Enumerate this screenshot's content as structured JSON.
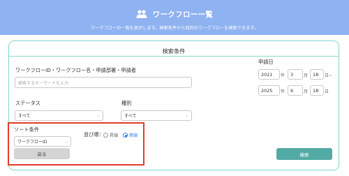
{
  "header": {
    "title": "ワークフロー一覧",
    "subtitle": "ワークフローの一覧を表示します。検索条件から目的のワークフローを検索できます。",
    "icon": "users-icon",
    "bg_color": "#8fb2f1"
  },
  "search": {
    "title": "検索条件",
    "keyword_label": "ワークフローID・ワークフロー名・申請部署・申請者",
    "keyword_placeholder": "検索するキーワードを入力",
    "status_label": "ステータス",
    "status_value": "すべて",
    "type_label": "種別",
    "type_value": "すべて",
    "sort_label": "ソート条件",
    "sort_value": "ワークフローID",
    "order_label": "並び順：",
    "order_asc": "昇順",
    "order_desc": "降順",
    "order_selected": "降順",
    "date_label": "申請日",
    "date_from": {
      "year": "2021",
      "month": "3",
      "day": "18",
      "suffix": "日~"
    },
    "date_to": {
      "year": "2025",
      "month": "6",
      "day": "18",
      "suffix": "日"
    },
    "year_unit": "年",
    "month_unit": "月",
    "back_button": "戻る",
    "search_button": "検索"
  },
  "colors": {
    "accent": "#53aaa5",
    "card_border": "#7fd6cb",
    "highlight": "#e23d2c",
    "radio_checked": "#2f7cf6"
  }
}
